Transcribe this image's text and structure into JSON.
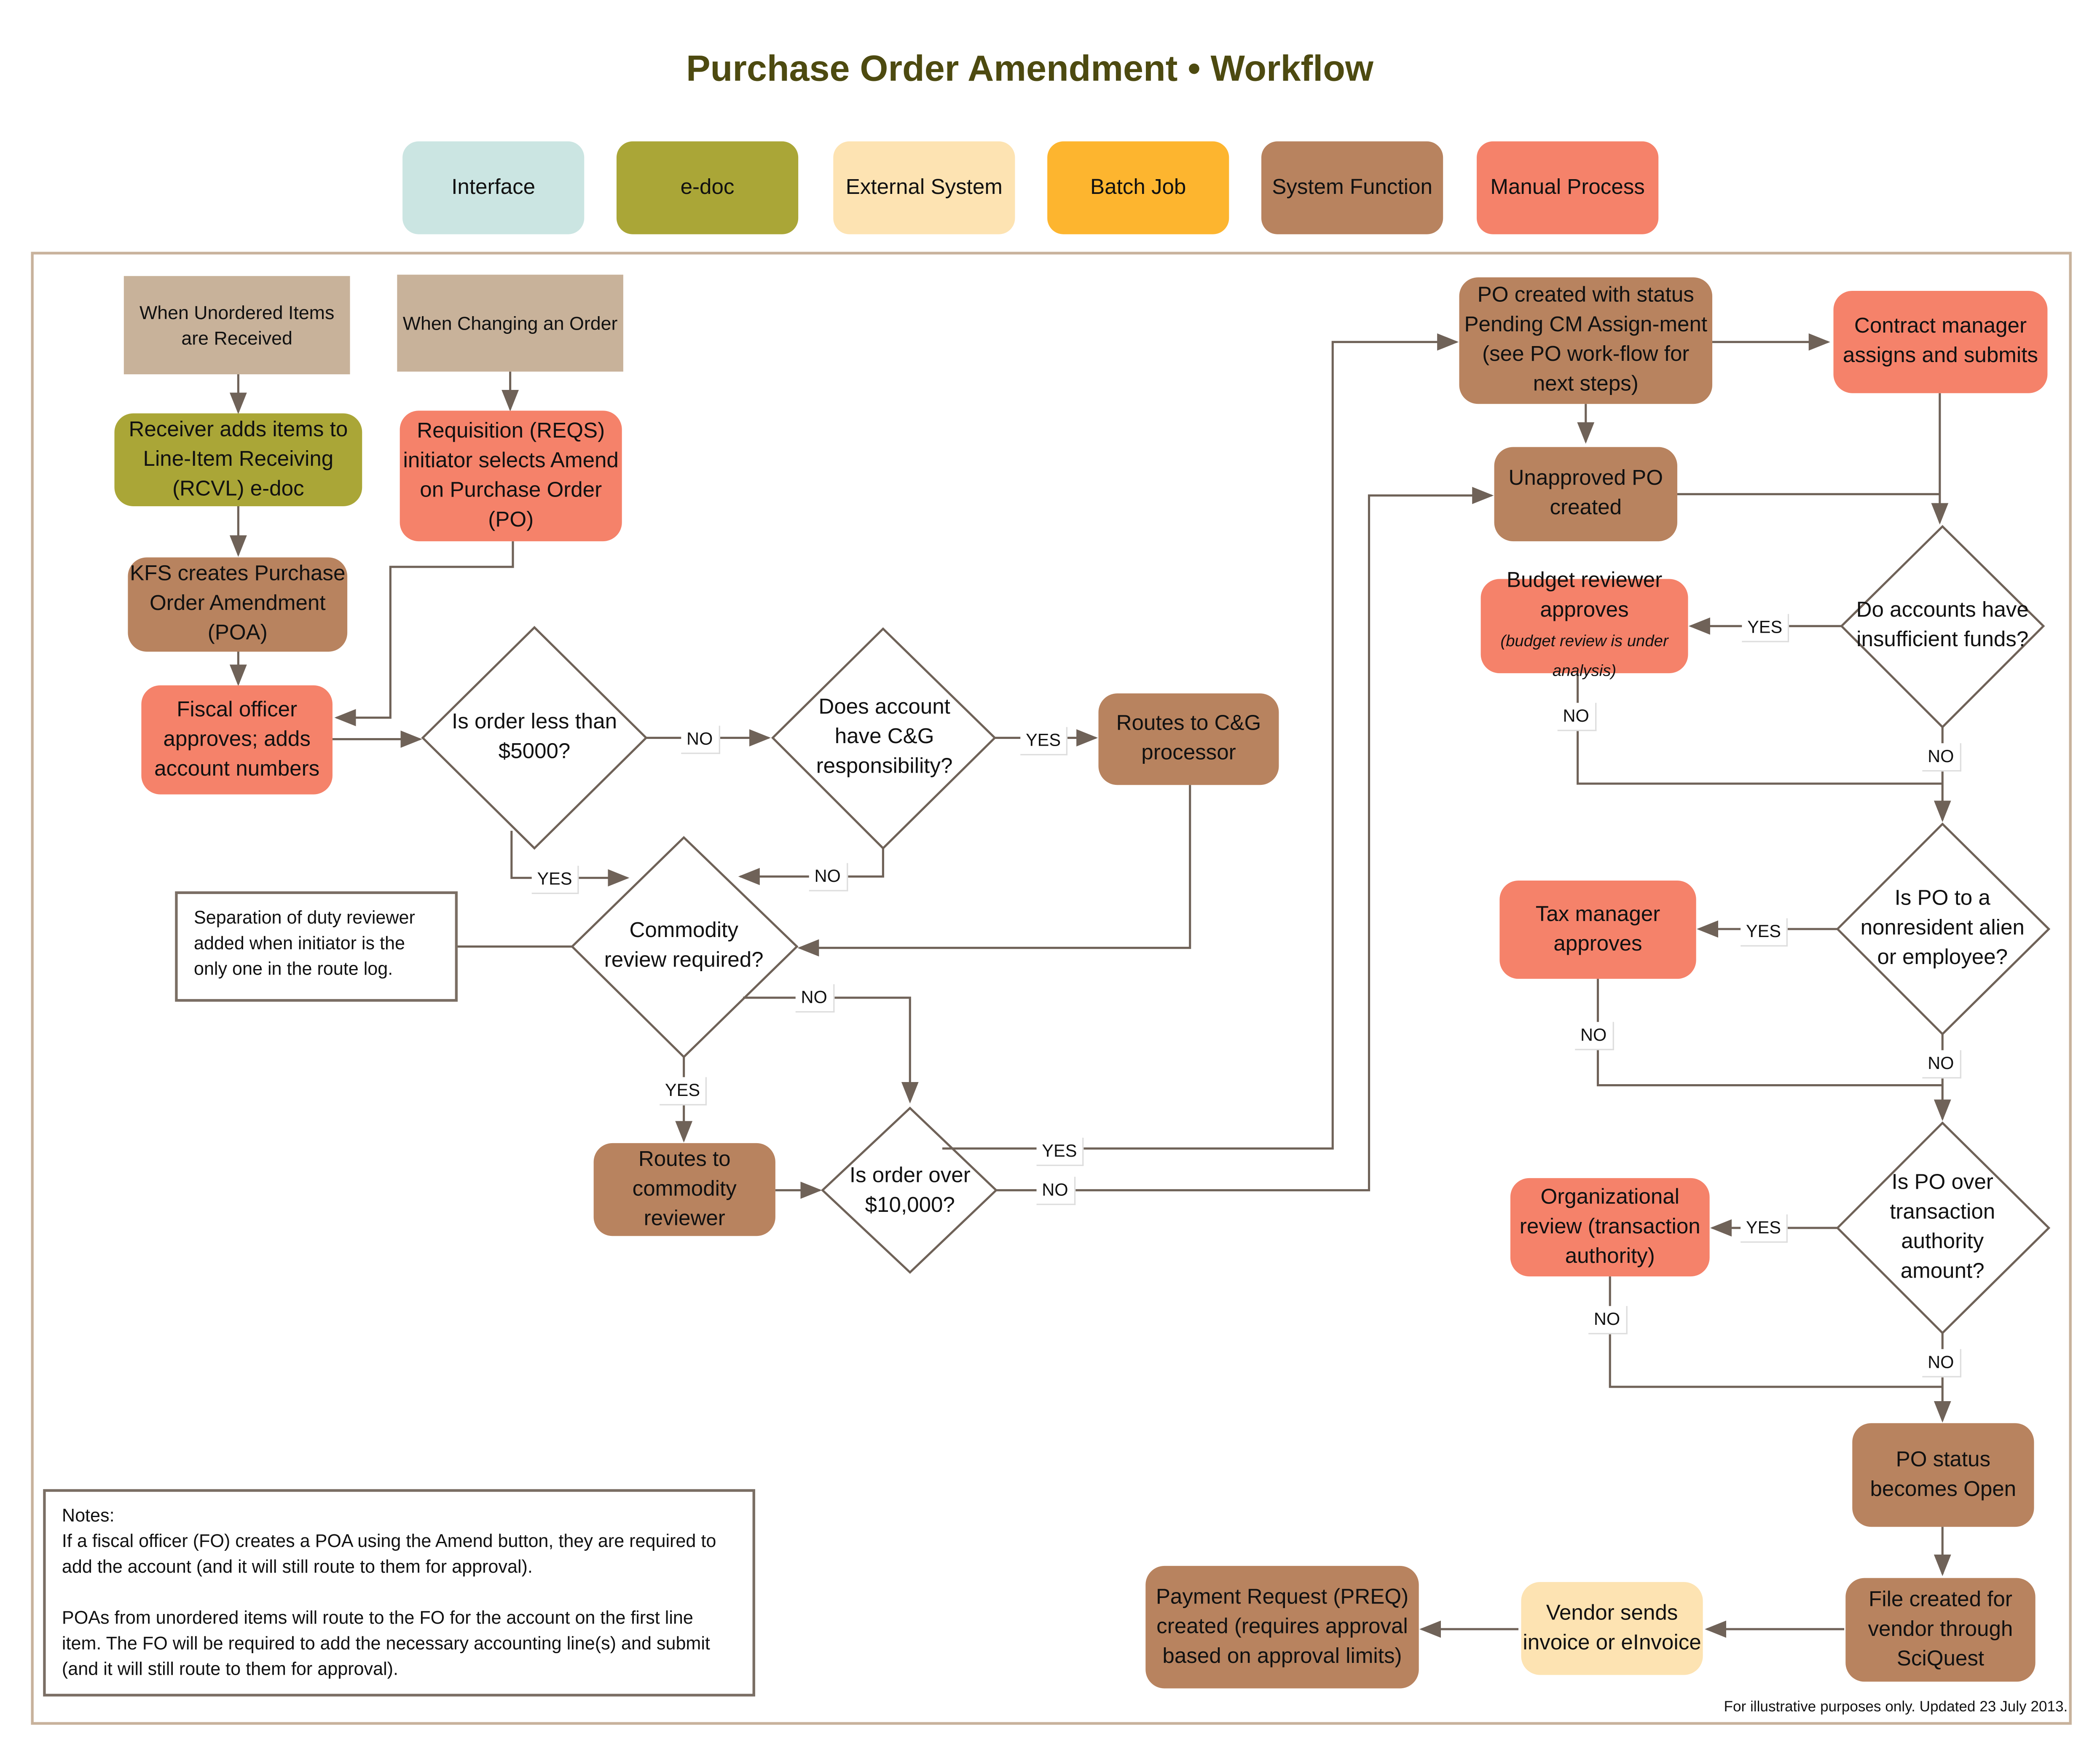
{
  "title": "Purchase Order Amendment • Workflow",
  "legend": [
    {
      "label": "Interface",
      "color": "#cbe5e2"
    },
    {
      "label": "e-doc",
      "color": "#aaa637"
    },
    {
      "label": "External System",
      "color": "#fde3b2"
    },
    {
      "label": "Batch Job",
      "color": "#fdb52f"
    },
    {
      "label": "System Function",
      "color": "#b8835f"
    },
    {
      "label": "Manual Process",
      "color": "#f5826a"
    }
  ],
  "triggers": {
    "unordered": "When Unordered Items are Received",
    "changing": "When Changing an Order"
  },
  "nodes": {
    "receiver": "Receiver adds items to Line-Item Receiving (RCVL) e-doc",
    "requisition": "Requisition (REQS) initiator selects Amend on Purchase Order (PO)",
    "kfs": "KFS creates Purchase Order Amendment (POA)",
    "fiscal": "Fiscal officer approves; adds account numbers",
    "cg_processor": "Routes to C&G processor",
    "commodity_reviewer": "Routes to commodity reviewer",
    "pending_cm": "PO created with status Pending CM Assign-ment (see PO work-flow for next steps)",
    "contract_manager": "Contract manager assigns and submits",
    "unapproved": "Unapproved PO created",
    "budget_main": "Budget reviewer approves",
    "budget_note": "(budget review is under analysis)",
    "tax": "Tax manager approves",
    "org_review": "Organizational review (transaction authority)",
    "po_open": "PO status becomes Open",
    "file_created": "File created for vendor through SciQuest",
    "vendor": "Vendor sends invoice or eInvoice",
    "preq": "Payment Request (PREQ) created (requires approval based on approval limits)"
  },
  "decisions": {
    "less5000": "Is order less than $5000?",
    "cg": "Does account have C&G responsibility?",
    "commodity": "Commodity review required?",
    "over10000": "Is order over $10,000?",
    "funds": "Do accounts have insufficient funds?",
    "nonresident": "Is PO to a nonresident alien or employee?",
    "transaction": "Is PO over transaction authority amount?"
  },
  "labels": {
    "yes": "YES",
    "no": "NO"
  },
  "separation_note": "Separation of duty reviewer added when initiator is the only one in the route log.",
  "notes": {
    "heading": "Notes:",
    "p1": "If a fiscal officer (FO) creates a POA using the Amend button, they are required to add the account (and it will still route to them for approval).",
    "p2": "POAs from unordered items will route to the FO for the account on the first line item. The FO will be required to add the necessary accounting line(s) and submit (and it will still route to them for approval)."
  },
  "footer": "For illustrative purposes only. Updated 23 July 2013."
}
